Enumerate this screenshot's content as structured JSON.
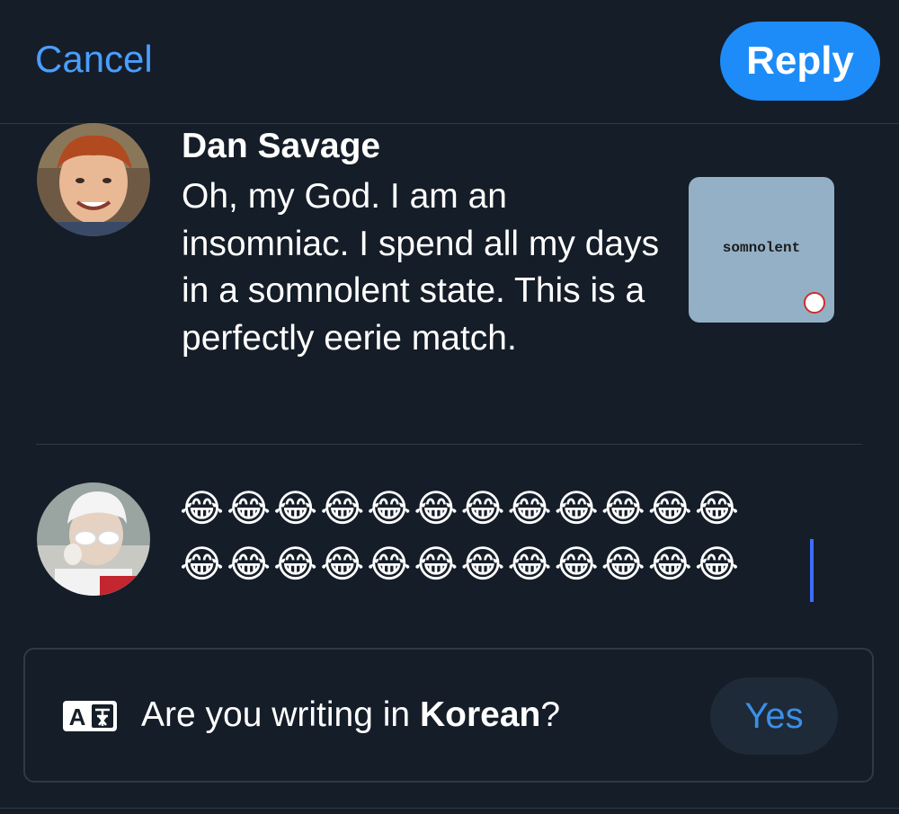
{
  "header": {
    "cancel_label": "Cancel",
    "reply_label": "Reply"
  },
  "tweet": {
    "author": "Dan Savage",
    "text": "Oh, my God. I am an insomniac. I spend all my days in a somnolent state. This is a perfectly eerie match.",
    "thumbnail_word": "somnolent"
  },
  "compose": {
    "line1": "😂😂😂😂😂😂😂😂😂😂😂😂",
    "line2": "😂😂😂😂😂😂😂😂😂😂😂😂"
  },
  "language_prompt": {
    "icon": "translate-icon",
    "question_prefix": "Are you writing in ",
    "language": "Korean",
    "question_suffix": "?",
    "yes_label": "Yes"
  },
  "colors": {
    "background": "#151d28",
    "accent": "#1d8cf8",
    "link": "#4a9eff",
    "divider": "#2e3a48"
  }
}
